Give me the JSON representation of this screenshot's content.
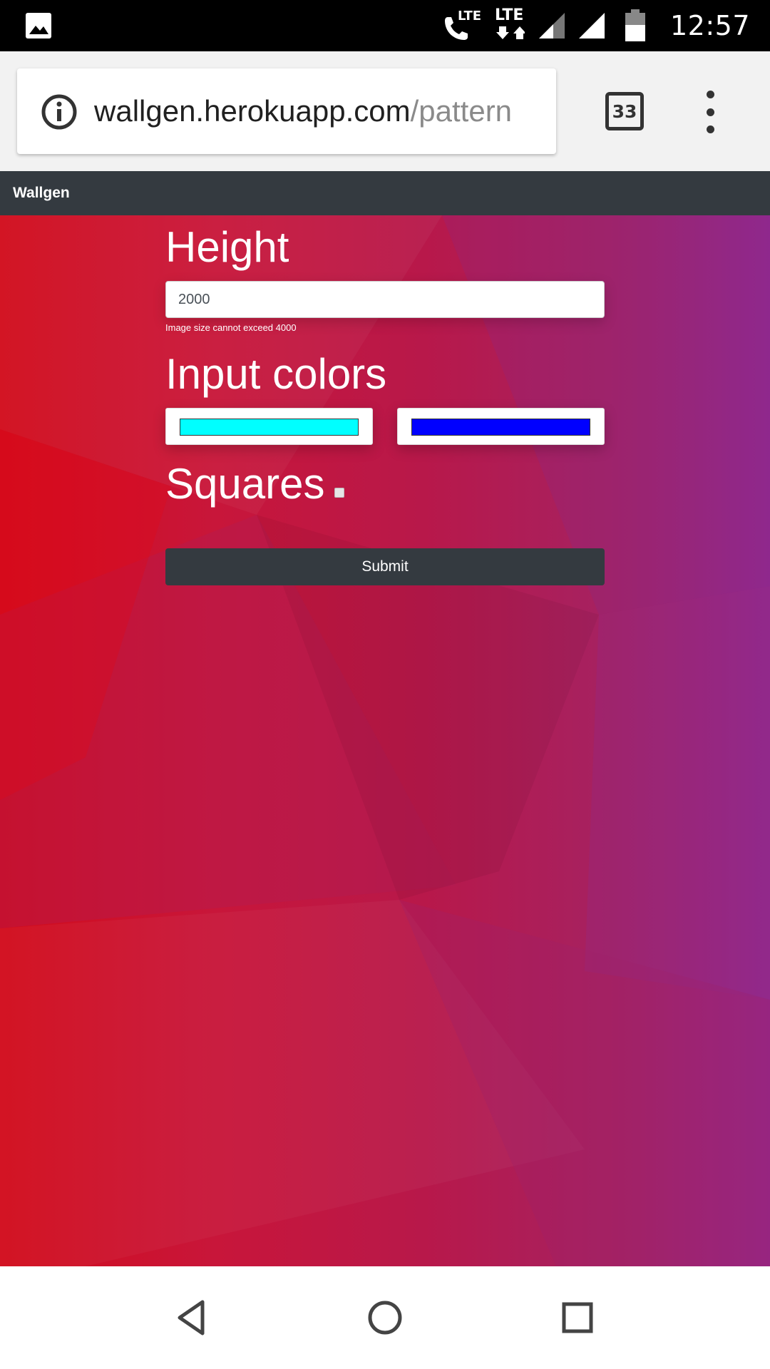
{
  "status_bar": {
    "time": "12:57",
    "lte_1": "LTE",
    "lte_2": "LTE",
    "icons": [
      "gallery-icon",
      "wifi-call-icon",
      "lte-icon",
      "signal-icon",
      "signal-full-icon",
      "battery-icon"
    ]
  },
  "browser": {
    "url_domain": "wallgen.herokuapp.com",
    "url_path": "/pattern",
    "tab_count": "33",
    "icons": [
      "info-icon",
      "tabs-icon",
      "more-vert-icon"
    ]
  },
  "navbar": {
    "brand": "Wallgen"
  },
  "form": {
    "height_label": "Height",
    "height_value": "2000",
    "height_hint": "Image size cannot exceed 4000",
    "colors_label": "Input colors",
    "color_1": "#00ffff",
    "color_2": "#0000ff",
    "squares_label": "Squares",
    "squares_checked": false,
    "submit_label": "Submit"
  },
  "android_nav": {
    "icons": [
      "back-icon",
      "home-icon",
      "recents-icon"
    ]
  }
}
